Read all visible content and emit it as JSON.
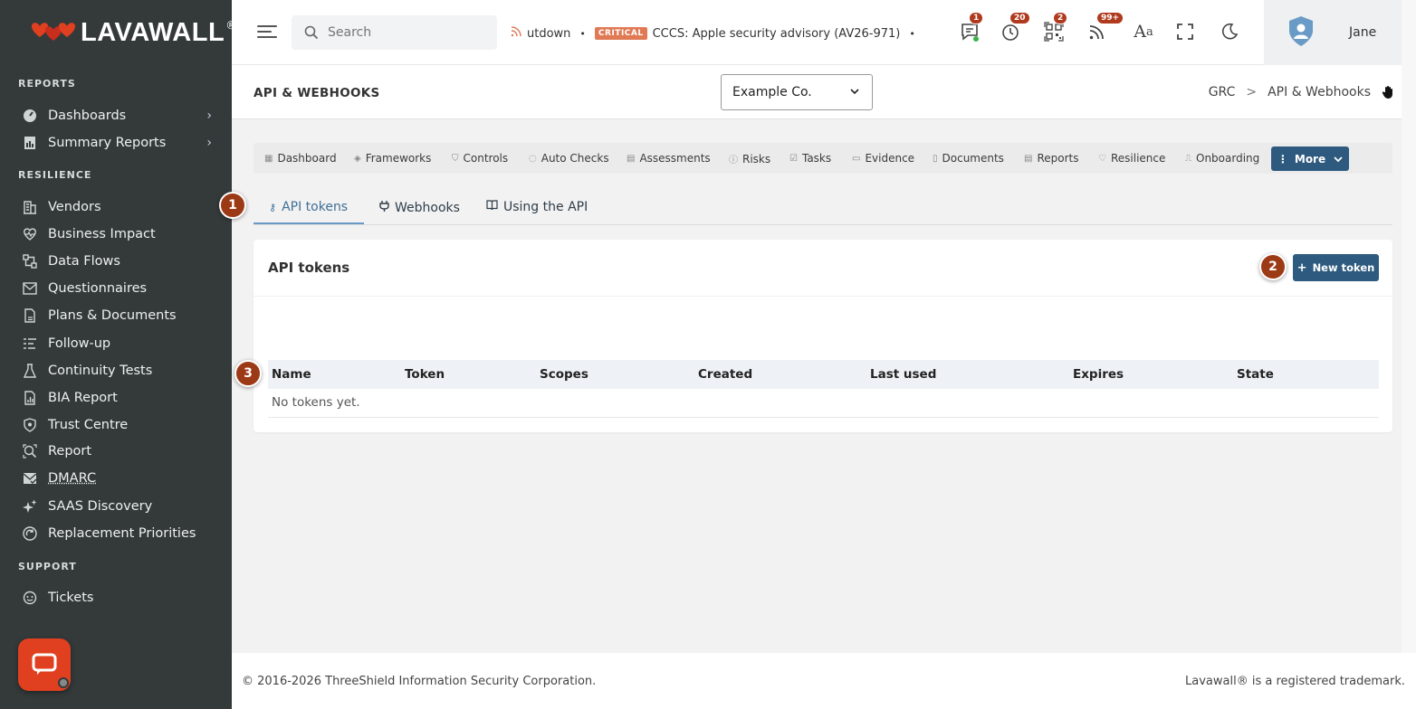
{
  "app": {
    "brand": "LAVAWALL",
    "brand_mark": "®"
  },
  "sidebar": {
    "sections": [
      {
        "title": "REPORTS"
      },
      {
        "title": "RESILIENCE"
      },
      {
        "title": "SUPPORT"
      }
    ],
    "items": [
      {
        "label": "Dashboards",
        "icon": "gauge-icon"
      },
      {
        "label": "Summary Reports",
        "icon": "report-chart-icon"
      },
      {
        "label": "Vendors",
        "icon": "building-icon"
      },
      {
        "label": "Business Impact",
        "icon": "heart-pulse-icon"
      },
      {
        "label": "Data Flows",
        "icon": "flow-icon"
      },
      {
        "label": "Questionnaires",
        "icon": "envelope-icon"
      },
      {
        "label": "Plans & Documents",
        "icon": "document-icon"
      },
      {
        "label": "Follow-up",
        "icon": "list-icon"
      },
      {
        "label": "Continuity Tests",
        "icon": "flask-icon"
      },
      {
        "label": "BIA Report",
        "icon": "bar-report-icon"
      },
      {
        "label": "Trust Centre",
        "icon": "shield-icon"
      },
      {
        "label": "Report",
        "icon": "search-report-icon"
      },
      {
        "label": "DMARC",
        "icon": "mail-check-icon"
      },
      {
        "label": "SAAS Discovery",
        "icon": "sparkle-icon"
      },
      {
        "label": "Replacement Priorities",
        "icon": "priority-icon"
      },
      {
        "label": "Tickets",
        "icon": "ticket-icon"
      }
    ]
  },
  "topbar": {
    "search_placeholder": "Search",
    "ticker": {
      "prev_text": "utdown",
      "critical_label": "CRITICAL",
      "item_text": "CCCS: Apple security advisory (AV26-971)",
      "close": "×"
    },
    "badges": {
      "messages": "1",
      "timers": "20",
      "qr": "2",
      "feeds": "99+"
    },
    "user_name": "Jane"
  },
  "page": {
    "title": "API & WEBHOOKS",
    "company": "Example Co.",
    "breadcrumb": [
      "GRC",
      "API & Webhooks"
    ],
    "breadcrumb_sep": ">"
  },
  "nav_tabs": [
    {
      "label": "Dashboard",
      "icon": "grid-icon"
    },
    {
      "label": "Frameworks",
      "icon": "layers-icon"
    },
    {
      "label": "Controls",
      "icon": "shield-small-icon"
    },
    {
      "label": "Auto Checks",
      "icon": "auto-check-icon"
    },
    {
      "label": "Assessments",
      "icon": "clipboard-icon"
    },
    {
      "label": "Risks",
      "icon": "alert-circle-icon"
    },
    {
      "label": "Tasks",
      "icon": "checkbox-icon"
    },
    {
      "label": "Evidence",
      "icon": "folder-icon"
    },
    {
      "label": "Documents",
      "icon": "docs-icon"
    },
    {
      "label": "Reports",
      "icon": "report-icon"
    },
    {
      "label": "Resilience",
      "icon": "heart-icon"
    },
    {
      "label": "Onboarding",
      "icon": "onboard-icon"
    }
  ],
  "more_button": "More",
  "sub_tabs": [
    {
      "label": "API tokens",
      "icon": "key-icon",
      "active": true
    },
    {
      "label": "Webhooks",
      "icon": "plug-icon"
    },
    {
      "label": "Using the API",
      "icon": "book-icon"
    }
  ],
  "card": {
    "title": "API tokens",
    "new_button": "New token",
    "new_button_icon": "+",
    "columns": [
      "Name",
      "Token",
      "Scopes",
      "Created",
      "Last used",
      "Expires",
      "State"
    ],
    "empty_text": "No tokens yet."
  },
  "markers": [
    "1",
    "2",
    "3"
  ],
  "footer": {
    "left": "© 2016-2026 ThreeShield Information Security Corporation.",
    "right": "Lavawall® is a registered trademark."
  },
  "colors": {
    "sidebar_bg": "#343a3a",
    "primary_button": "#2d5a7e",
    "marker": "#9c3a16",
    "brand_red": "#e0401f"
  }
}
